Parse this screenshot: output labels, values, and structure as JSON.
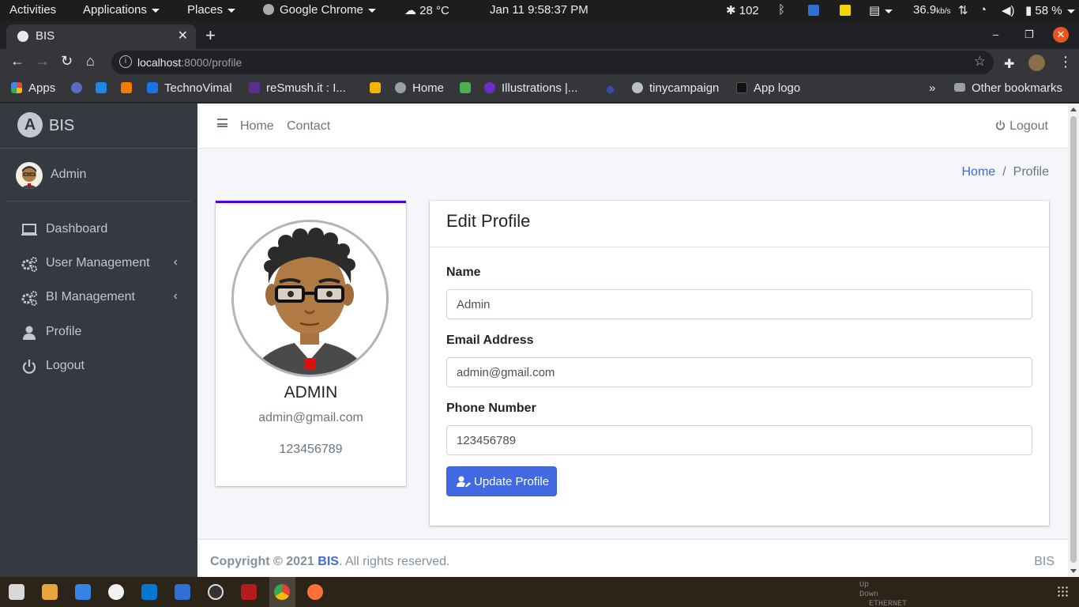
{
  "system_bar": {
    "activities": "Activities",
    "applications": "Applications",
    "places": "Places",
    "active_app": "Google Chrome",
    "weather": "28 °C",
    "datetime": "Jan 11  9:58:37 PM",
    "notif_count": "102",
    "net_speed": "36.9",
    "net_unit": "kb/s",
    "battery": "58 %"
  },
  "browser": {
    "tab_title": "BIS",
    "url_host": "localhost",
    "url_path": ":8000/profile",
    "bookmarks": [
      {
        "label": "Apps",
        "color": "#e8453c"
      },
      {
        "label": "TechnoVimal",
        "color": "#1a73e8"
      },
      {
        "label": "reSmush.it : I...",
        "color": "#5b2d8e"
      },
      {
        "label": "Home",
        "color": "#9aa0a6"
      },
      {
        "label": "Illustrations |...",
        "color": "#6c2dc7"
      },
      {
        "label": "tinycampaign",
        "color": "#bdc1c6"
      },
      {
        "label": "App logo",
        "color": "#111111"
      }
    ],
    "other_bookmarks": "Other bookmarks"
  },
  "sidebar": {
    "brand": "BIS",
    "brand_logo_letter": "A",
    "user_name": "Admin",
    "items": [
      {
        "label": "Dashboard",
        "icon": "laptop-icon"
      },
      {
        "label": "User Management",
        "icon": "cogs-icon"
      },
      {
        "label": "BI Management",
        "icon": "cogs-icon"
      },
      {
        "label": "Profile",
        "icon": "user-icon"
      },
      {
        "label": "Logout",
        "icon": "power-icon"
      }
    ]
  },
  "header": {
    "home": "Home",
    "contact": "Contact",
    "logout": "Logout"
  },
  "breadcrumb": {
    "home": "Home",
    "separator": "/",
    "current": "Profile"
  },
  "profile_card": {
    "name": "ADMIN",
    "email": "admin@gmail.com",
    "phone": "123456789"
  },
  "edit_form": {
    "title": "Edit Profile",
    "name_label": "Name",
    "name_value": "Admin",
    "email_label": "Email Address",
    "email_value": "admin@gmail.com",
    "phone_label": "Phone Number",
    "phone_value": "123456789",
    "submit_label": "Update Profile"
  },
  "footer": {
    "copyright_prefix": "Copyright © 2021 ",
    "brand": "BIS",
    "suffix": ". All rights reserved.",
    "right": "BIS"
  },
  "dock": {
    "net_up": "Up",
    "net_down": "Down",
    "net_iface": "ETHERNET"
  },
  "colors": {
    "sidebar_bg": "#343a40",
    "accent": "#4169e1",
    "card_top_border": "#4b06e0"
  }
}
